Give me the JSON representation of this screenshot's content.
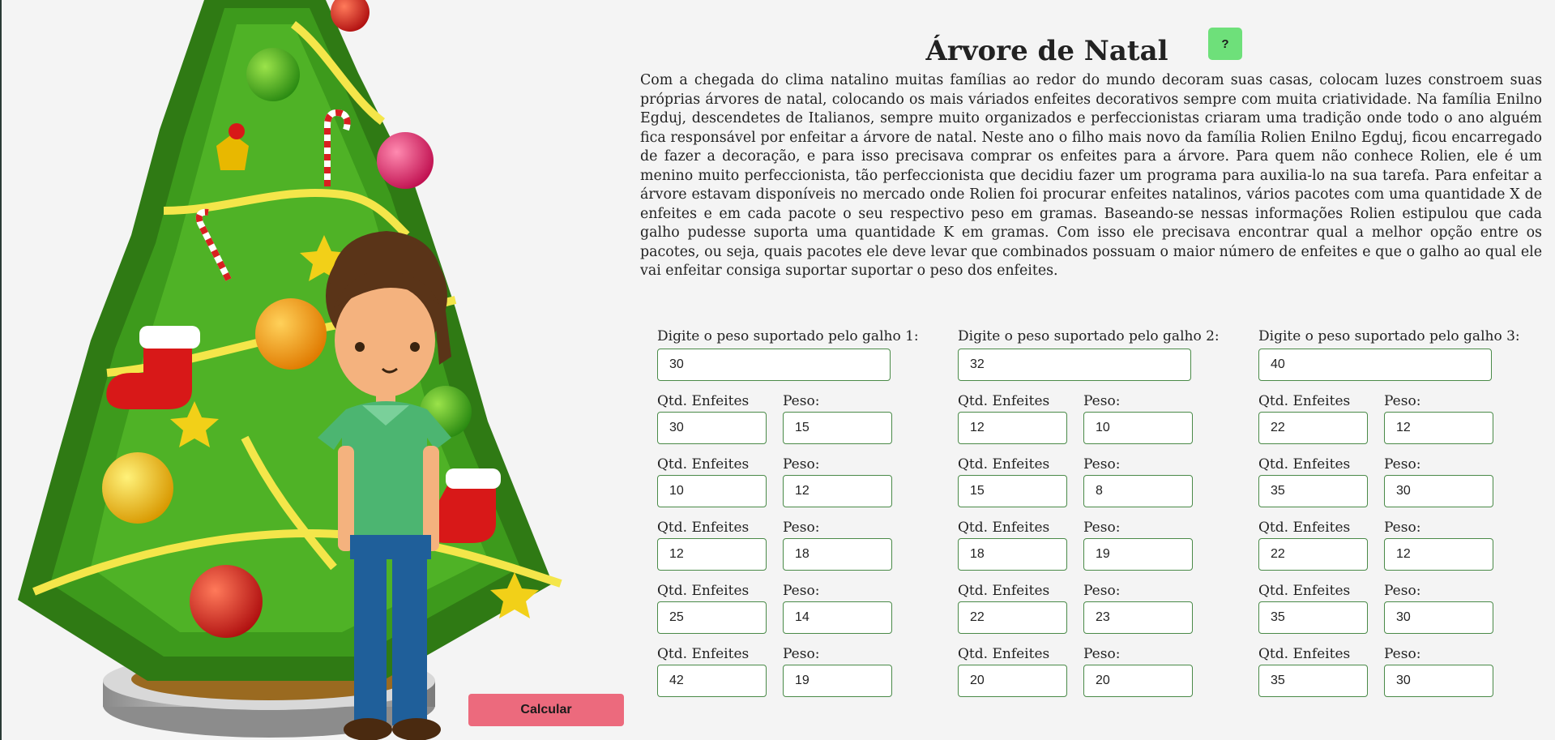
{
  "title": "Árvore de Natal",
  "help_label": "?",
  "description": "Com a chegada do clima natalino muitas famílias ao redor do mundo decoram suas casas, colocam luzes constroem suas próprias árvores de natal, colocando os mais váriados enfeites decorativos sempre com muita criatividade. Na família Enilno Egduj, descendetes de Italianos, sempre muito organizados e perfeccionistas criaram uma tradição onde todo o ano alguém fica responsável por enfeitar a árvore de natal. Neste ano o filho mais novo da família Rolien Enilno Egduj, ficou encarregado de fazer a decoração, e para isso precisava comprar os enfeites para a árvore. Para quem não conhece Rolien, ele é um menino muito perfeccionista, tão perfeccionista que decidiu fazer um programa para auxilia-lo na sua tarefa. Para enfeitar a árvore estavam disponíveis no mercado onde Rolien foi procurar enfeites natalinos, vários pacotes com uma quantidade X de enfeites e em cada pacote o seu respectivo peso em gramas. Baseando-se nessas informações Rolien estipulou que cada galho pudesse suporta uma quantidade K em gramas. Com isso ele precisava encontrar qual a melhor opção entre os pacotes, ou seja, quais pacotes ele deve levar que combinados possuam o maior número de enfeites e que o galho ao qual ele vai enfeitar consiga suportar suportar o peso dos enfeites.",
  "qty_label": "Qtd. Enfeites",
  "peso_label": "Peso:",
  "calc_label": "Calcular",
  "branches": [
    {
      "label": "Digite o peso suportado pelo galho 1:",
      "weight": "30",
      "packs": [
        {
          "qty": "30",
          "peso": "15"
        },
        {
          "qty": "10",
          "peso": "12"
        },
        {
          "qty": "12",
          "peso": "18"
        },
        {
          "qty": "25",
          "peso": "14"
        },
        {
          "qty": "42",
          "peso": "19"
        }
      ]
    },
    {
      "label": "Digite o peso suportado pelo galho 2:",
      "weight": "32",
      "packs": [
        {
          "qty": "12",
          "peso": "10"
        },
        {
          "qty": "15",
          "peso": "8"
        },
        {
          "qty": "18",
          "peso": "19"
        },
        {
          "qty": "22",
          "peso": "23"
        },
        {
          "qty": "20",
          "peso": "20"
        }
      ]
    },
    {
      "label": "Digite o peso suportado pelo galho 3:",
      "weight": "40",
      "packs": [
        {
          "qty": "22",
          "peso": "12"
        },
        {
          "qty": "35",
          "peso": "30"
        },
        {
          "qty": "22",
          "peso": "12"
        },
        {
          "qty": "35",
          "peso": "30"
        },
        {
          "qty": "35",
          "peso": "30"
        }
      ]
    }
  ]
}
